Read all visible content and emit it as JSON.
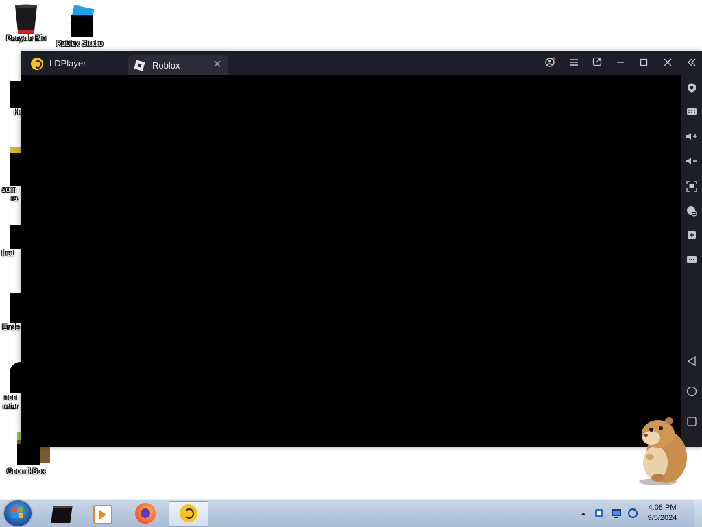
{
  "desktop": {
    "icons": [
      {
        "label": "Recycle Bin",
        "icon": "recycle-bin-icon"
      },
      {
        "label": "Roblox Studio",
        "icon": "roblox-studio-icon"
      },
      {
        "label": "Ho",
        "icon": "shortcut-icon"
      },
      {
        "label": "som",
        "label2": "ra",
        "icon": "shortcut-icon"
      },
      {
        "label": "that",
        "icon": "shortcut-icon"
      },
      {
        "label": "Ende",
        "icon": "shortcut-icon"
      },
      {
        "label": "non",
        "label2": "retar",
        "icon": "shortcut-icon"
      },
      {
        "label": "GnomikBox",
        "icon": "shortcut-icon"
      }
    ]
  },
  "emulator": {
    "app_name": "LDPlayer",
    "tab_title": "Roblox",
    "tab_close": "✕",
    "title_controls": [
      "account-icon",
      "menu-icon",
      "popout-icon",
      "minimize-icon",
      "maximize-icon",
      "close-icon",
      "collapse-sidebar-icon"
    ],
    "sidebar_tools": [
      "settings-icon",
      "keyboard-mapping-icon",
      "volume-up-icon",
      "volume-down-icon",
      "screenshot-icon",
      "install-apk-icon",
      "add-icon",
      "more-icon"
    ],
    "nav_buttons": [
      "back-icon",
      "home-icon",
      "recents-icon"
    ]
  },
  "taskbar": {
    "apps": [
      "start-orb-icon",
      "black-app-icon",
      "media-player-icon",
      "firefox-icon",
      "ldplayer-icon"
    ],
    "tray": [
      "show-hidden-icons",
      "network-icon",
      "display-icon",
      "sync-icon"
    ],
    "time": "4:08 PM",
    "date": "9/5/2024"
  },
  "colors": {
    "titlebar": "#1e1e26",
    "tab_active": "#2c2c36",
    "ldplayer_yellow": "#f6c21c",
    "taskbar": "#b8c9dd"
  }
}
